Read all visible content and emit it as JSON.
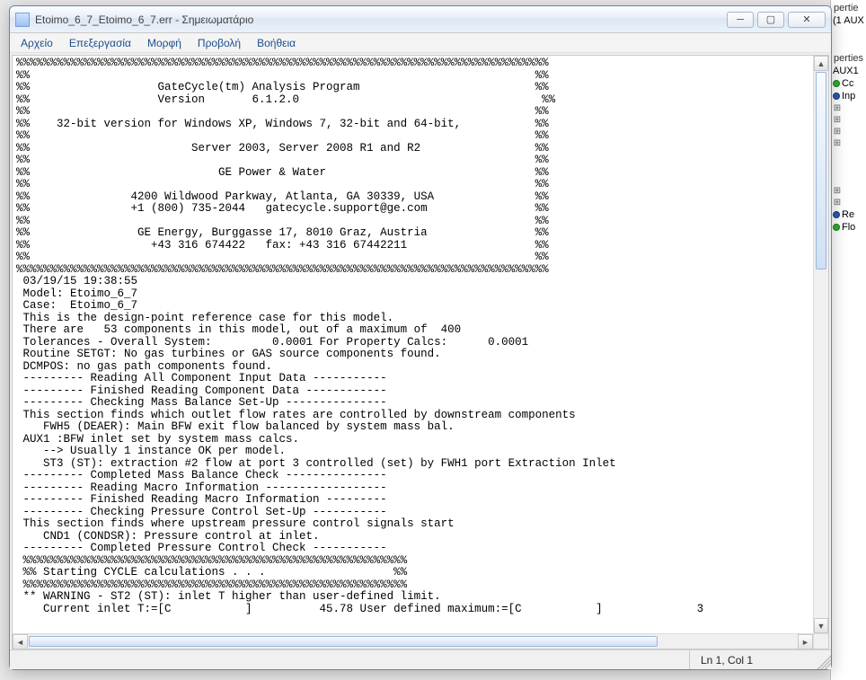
{
  "window": {
    "title": "Etoimo_6_7_Etoimo_6_7.err - Σημειωματάριο"
  },
  "menu": {
    "file": "Αρχείο",
    "edit": "Επεξεργασία",
    "format": "Μορφή",
    "view": "Προβολή",
    "help": "Βοήθεια"
  },
  "status": {
    "pos": "Ln 1, Col 1"
  },
  "bg": {
    "hdr1": "pertie",
    "aux": "(1 AUX",
    "hdr2": "perties",
    "aux1": "AUX1",
    "cc": "Cc",
    "inp": "Inp",
    "re": "Re",
    "flo": "Flo"
  },
  "content": "%%%%%%%%%%%%%%%%%%%%%%%%%%%%%%%%%%%%%%%%%%%%%%%%%%%%%%%%%%%%%%%%%%%%%%%%%%%%%%%\n%%                                                                           %%\n%%                   GateCycle(tm) Analysis Program                          %%\n%%                   Version       6.1.2.0                                    %%\n%%                                                                           %%\n%%    32-bit version for Windows XP, Windows 7, 32-bit and 64-bit,           %%\n%%                                                                           %%\n%%                        Server 2003, Server 2008 R1 and R2                 %%\n%%                                                                           %%\n%%                            GE Power & Water                               %%\n%%                                                                           %%\n%%               4200 Wildwood Parkway, Atlanta, GA 30339, USA               %%\n%%               +1 (800) 735-2044   gatecycle.support@ge.com                %%\n%%                                                                           %%\n%%                GE Energy, Burggasse 17, 8010 Graz, Austria                %%\n%%                  +43 316 674422   fax: +43 316 67442211                   %%\n%%                                                                           %%\n%%%%%%%%%%%%%%%%%%%%%%%%%%%%%%%%%%%%%%%%%%%%%%%%%%%%%%%%%%%%%%%%%%%%%%%%%%%%%%%\n 03/19/15 19:38:55\n Model: Etoimo_6_7\n Case:  Etoimo_6_7\n This is the design-point reference case for this model.\n There are   53 components in this model, out of a maximum of  400\n Tolerances - Overall System:         0.0001 For Property Calcs:      0.0001\n Routine SETGT: No gas turbines or GAS source components found.\n DCMPOS: no gas path components found.\n --------- Reading All Component Input Data -----------\n --------- Finished Reading Component Data ------------\n --------- Checking Mass Balance Set-Up ---------------\n This section finds which outlet flow rates are controlled by downstream components\n    FWH5 (DEAER): Main BFW exit flow balanced by system mass bal.\n AUX1 :BFW inlet set by system mass calcs.\n    --> Usually 1 instance OK per model.\n    ST3 (ST): extraction #2 flow at port 3 controlled (set) by FWH1 port Extraction Inlet\n --------- Completed Mass Balance Check ---------------\n --------- Reading Macro Information ------------------\n --------- Finished Reading Macro Information ---------\n --------- Checking Pressure Control Set-Up -----------\n This section finds where upstream pressure control signals start\n    CND1 (CONDSR): Pressure control at inlet.\n --------- Completed Pressure Control Check -----------\n %%%%%%%%%%%%%%%%%%%%%%%%%%%%%%%%%%%%%%%%%%%%%%%%%%%%%%%%%\n %% Starting CYCLE calculations . . .                   %%\n %%%%%%%%%%%%%%%%%%%%%%%%%%%%%%%%%%%%%%%%%%%%%%%%%%%%%%%%%\n ** WARNING - ST2 (ST): inlet T higher than user-defined limit.\n    Current inlet T:=[C           ]          45.78 User defined maximum:=[C           ]              3"
}
